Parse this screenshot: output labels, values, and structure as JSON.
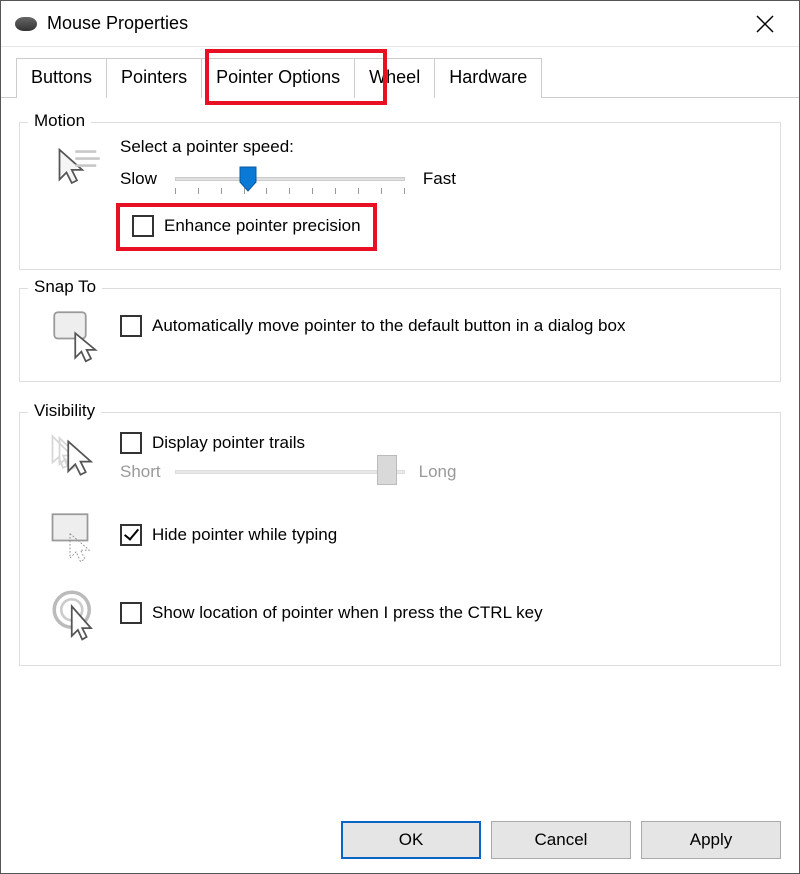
{
  "window": {
    "title": "Mouse Properties"
  },
  "tabs": [
    "Buttons",
    "Pointers",
    "Pointer Options",
    "Wheel",
    "Hardware"
  ],
  "active_tab": "Pointer Options",
  "motion": {
    "legend": "Motion",
    "speed_label": "Select a pointer speed:",
    "slow": "Slow",
    "fast": "Fast",
    "enhance_label": "Enhance pointer precision",
    "enhance_checked": false,
    "speed_position_percent": 28
  },
  "snap": {
    "legend": "Snap To",
    "auto_label": "Automatically move pointer to the default button in a dialog box",
    "auto_checked": false
  },
  "visibility": {
    "legend": "Visibility",
    "trails_label": "Display pointer trails",
    "trails_checked": false,
    "trails_short": "Short",
    "trails_long": "Long",
    "hide_label": "Hide pointer while typing",
    "hide_checked": true,
    "ctrl_label": "Show location of pointer when I press the CTRL key",
    "ctrl_checked": false
  },
  "buttons": {
    "ok": "OK",
    "cancel": "Cancel",
    "apply": "Apply"
  }
}
